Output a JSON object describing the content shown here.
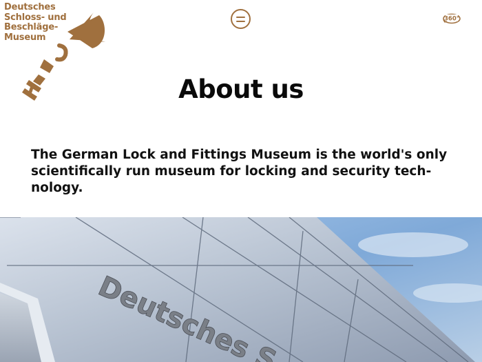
{
  "logo": {
    "lines": [
      "Deutsches",
      "Schloss- und",
      "Beschläge-",
      "Museum"
    ],
    "color": "#a0703e"
  },
  "header": {
    "menu_icon": "hamburger-menu-icon",
    "tour_label": "360°",
    "tour_icon": "360-view-icon"
  },
  "main": {
    "title": "About us",
    "intro": "The German Lock and Fittings Museum is the world's only scientifically run museum for locking and security tech­nology."
  },
  "hero": {
    "facade_lettering": "Deutsches S"
  }
}
